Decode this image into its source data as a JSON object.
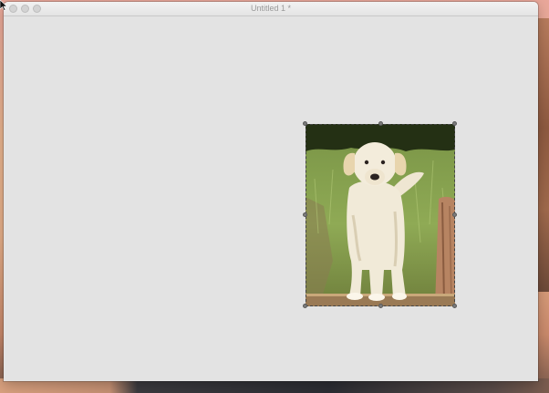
{
  "window": {
    "title": "Untitled 1 *",
    "buttons": [
      "close",
      "minimize",
      "zoom"
    ]
  },
  "canvas": {
    "background": "#e3e3e3",
    "placed_image": {
      "subject": "photo",
      "selected": true
    }
  },
  "icons": {
    "cursor": "arrow-pointer-icon"
  }
}
